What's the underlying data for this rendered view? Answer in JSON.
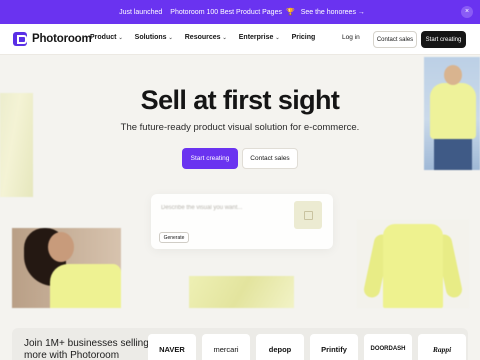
{
  "banner": {
    "just_launched": "Just launched",
    "headline": "Photoroom 100 Best Product Pages",
    "trophy": "🏆",
    "honorees": "See the honorees →",
    "close_icon": "×"
  },
  "nav": {
    "brand": "Photoroom",
    "menu": [
      {
        "label": "Product",
        "chevron": "⌄"
      },
      {
        "label": "Solutions",
        "chevron": "⌄"
      },
      {
        "label": "Resources",
        "chevron": "⌄"
      },
      {
        "label": "Enterprise",
        "chevron": "⌄"
      },
      {
        "label": "Pricing",
        "chevron": ""
      }
    ],
    "login": "Log in",
    "contact": "Contact sales",
    "start": "Start creating"
  },
  "hero": {
    "title": "Sell at first sight",
    "subtitle": "The future-ready product visual solution for e-commerce.",
    "primary_cta": "Start creating",
    "secondary_cta": "Contact sales"
  },
  "prompt_card": {
    "placeholder": "Describe the visual you want...",
    "generate": "Generate"
  },
  "logos_strip": {
    "line1": "Join 1M+ businesses selling",
    "line2": "more with Photoroom",
    "brands": [
      "NAVER",
      "mercari",
      "depop",
      "Printify",
      "DOORDASH",
      "Rappi"
    ]
  },
  "colors": {
    "accent": "#6a33f0",
    "dark_button": "#151515",
    "page_background": "#f4f3ef"
  }
}
